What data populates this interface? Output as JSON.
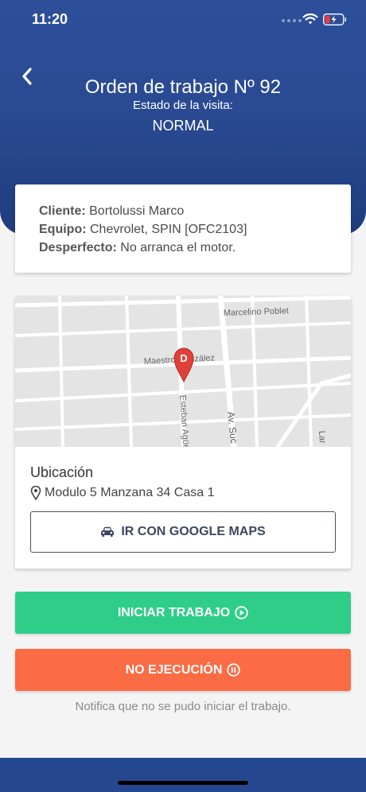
{
  "status": {
    "time": "11:20"
  },
  "header": {
    "title": "Orden de trabajo Nº 92",
    "subtitle": "Estado de la visita:",
    "state": "NORMAL"
  },
  "info": {
    "client_label": "Cliente:",
    "client_value": "Bortolussi Marco",
    "equipment_label": "Equipo:",
    "equipment_value": "Chevrolet, SPIN [OFC2103]",
    "defect_label": "Desperfecto:",
    "defect_value": "No arranca el motor."
  },
  "map": {
    "streets": [
      "Marcelino Poblet",
      "Maestro González",
      "Esteban Agüero",
      "Av. Suc",
      "Lar"
    ],
    "marker_letter": "D",
    "marker_color": "#e0423a"
  },
  "location": {
    "title": "Ubicación",
    "address": "Modulo 5 Manzana 34 Casa 1",
    "maps_button": "IR CON GOOGLE MAPS"
  },
  "actions": {
    "start_label": "INICIAR TRABAJO",
    "start_color": "#2ecd88",
    "noexec_label": "NO EJECUCIÓN",
    "noexec_color": "#fb6b44",
    "note": "Notifica que no se pudo iniciar el trabajo."
  },
  "icons": {
    "back": "chevron-left-icon",
    "pin": "map-pin-icon",
    "car": "car-icon",
    "play": "play-circle-icon",
    "pause": "pause-circle-icon"
  }
}
